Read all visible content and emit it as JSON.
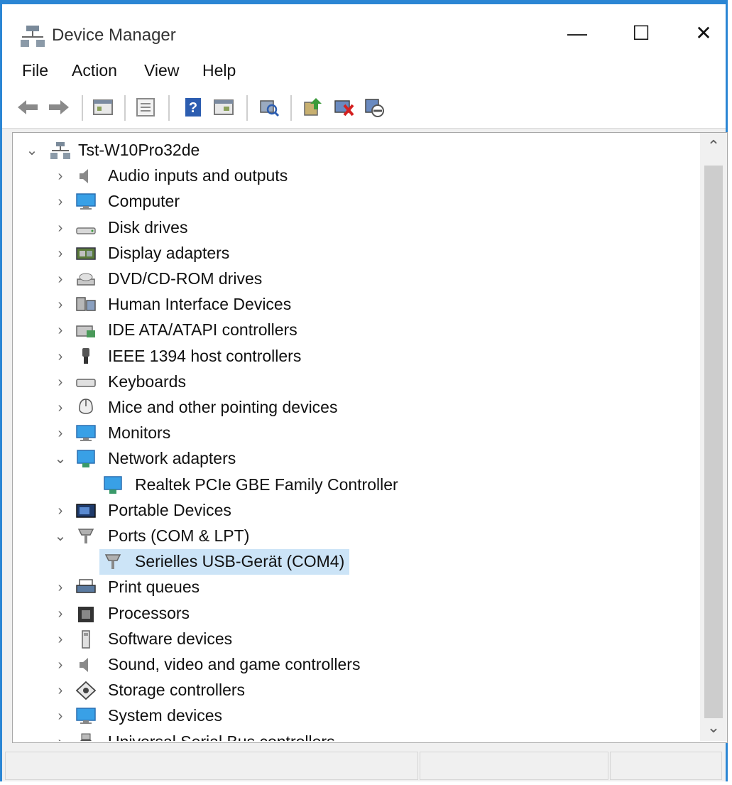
{
  "window": {
    "title": "Device Manager",
    "icon": "computer-tree-icon"
  },
  "window_controls": {
    "minimize": "—",
    "maximize": "☐",
    "close": "✕"
  },
  "menu": {
    "file": "File",
    "action": "Action",
    "view": "View",
    "help": "Help"
  },
  "toolbar": [
    {
      "name": "back-icon"
    },
    {
      "name": "forward-icon"
    },
    {
      "name": "properties-view-icon"
    },
    {
      "name": "show-hide-console-icon"
    },
    {
      "name": "help-icon"
    },
    {
      "name": "view-icon"
    },
    {
      "name": "scan-hardware-icon"
    },
    {
      "name": "update-driver-icon"
    },
    {
      "name": "uninstall-device-icon"
    },
    {
      "name": "disable-device-icon"
    }
  ],
  "tree": {
    "root": {
      "label": "Tst-W10Pro32de",
      "expanded": true,
      "icon": "computer-icon"
    },
    "items": [
      {
        "label": "Audio inputs and outputs",
        "icon": "speaker-icon",
        "level": 1,
        "expander": "collapsed"
      },
      {
        "label": "Computer",
        "icon": "monitor-icon",
        "level": 1,
        "expander": "collapsed"
      },
      {
        "label": "Disk drives",
        "icon": "disk-icon",
        "level": 1,
        "expander": "collapsed"
      },
      {
        "label": "Display adapters",
        "icon": "display-adapter-icon",
        "level": 1,
        "expander": "collapsed"
      },
      {
        "label": "DVD/CD-ROM drives",
        "icon": "dvd-icon",
        "level": 1,
        "expander": "collapsed"
      },
      {
        "label": "Human Interface Devices",
        "icon": "hid-icon",
        "level": 1,
        "expander": "collapsed"
      },
      {
        "label": "IDE ATA/ATAPI controllers",
        "icon": "ide-icon",
        "level": 1,
        "expander": "collapsed"
      },
      {
        "label": "IEEE 1394 host controllers",
        "icon": "ieee1394-icon",
        "level": 1,
        "expander": "collapsed"
      },
      {
        "label": "Keyboards",
        "icon": "keyboard-icon",
        "level": 1,
        "expander": "collapsed"
      },
      {
        "label": "Mice and other pointing devices",
        "icon": "mouse-icon",
        "level": 1,
        "expander": "collapsed"
      },
      {
        "label": "Monitors",
        "icon": "monitor-icon",
        "level": 1,
        "expander": "collapsed"
      },
      {
        "label": "Network adapters",
        "icon": "network-icon",
        "level": 1,
        "expander": "expanded"
      },
      {
        "label": "Realtek PCIe GBE Family Controller",
        "icon": "network-icon",
        "level": 2,
        "expander": "none"
      },
      {
        "label": "Portable Devices",
        "icon": "portable-device-icon",
        "level": 1,
        "expander": "collapsed"
      },
      {
        "label": "Ports (COM & LPT)",
        "icon": "port-icon",
        "level": 1,
        "expander": "expanded"
      },
      {
        "label": "Serielles USB-Gerät (COM4)",
        "icon": "port-icon",
        "level": 2,
        "expander": "none",
        "selected": true
      },
      {
        "label": "Print queues",
        "icon": "printer-icon",
        "level": 1,
        "expander": "collapsed"
      },
      {
        "label": "Processors",
        "icon": "processor-icon",
        "level": 1,
        "expander": "collapsed"
      },
      {
        "label": "Software devices",
        "icon": "software-device-icon",
        "level": 1,
        "expander": "collapsed"
      },
      {
        "label": "Sound, video and game controllers",
        "icon": "speaker-icon",
        "level": 1,
        "expander": "collapsed"
      },
      {
        "label": "Storage controllers",
        "icon": "storage-icon",
        "level": 1,
        "expander": "collapsed"
      },
      {
        "label": "System devices",
        "icon": "monitor-icon",
        "level": 1,
        "expander": "collapsed"
      },
      {
        "label": "Universal Serial Bus controllers",
        "icon": "usb-icon",
        "level": 1,
        "expander": "collapsed"
      }
    ]
  },
  "scrollbar": {
    "up": "⌃",
    "down": "⌄"
  },
  "colors": {
    "accent": "#2b86d4",
    "selection": "#cce4f7"
  }
}
